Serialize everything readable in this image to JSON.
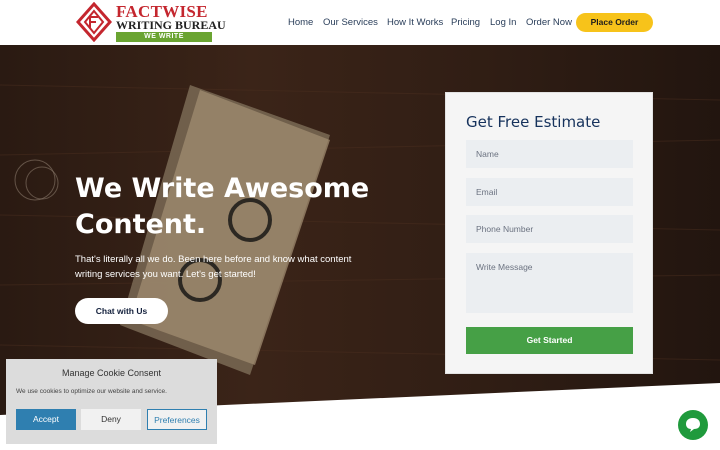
{
  "brand": {
    "line1": "FACTWISE",
    "line2": "WRITING BUREAU",
    "tagline": "WE WRITE"
  },
  "nav": {
    "items": [
      "Home",
      "Our Services",
      "How It Works",
      "Pricing",
      "Log In",
      "Order Now"
    ],
    "cta": "Place Order"
  },
  "hero": {
    "title": "We Write Awesome Content.",
    "subtitle": "That's literally all we do. Been here before and know what content writing services you want. Let's get started!",
    "chat_button": "Chat with Us"
  },
  "estimate_form": {
    "title": "Get Free Estimate",
    "name_placeholder": "Name",
    "email_placeholder": "Email",
    "phone_placeholder": "Phone Number",
    "message_placeholder": "Write Message",
    "submit": "Get Started"
  },
  "cookie": {
    "title": "Manage Cookie Consent",
    "text": "We use cookies to optimize our website and service.",
    "accept": "Accept",
    "deny": "Deny",
    "preferences": "Preferences"
  },
  "colors": {
    "accent_yellow": "#f7c31a",
    "submit_green": "#46a046",
    "brand_red": "#c4262e",
    "cookie_blue": "#2f7fb0",
    "chat_green": "#1f9a3c"
  },
  "icons": {
    "chat_widget": "chat-bubble-icon",
    "logo_mark": "fw-logo-icon"
  }
}
